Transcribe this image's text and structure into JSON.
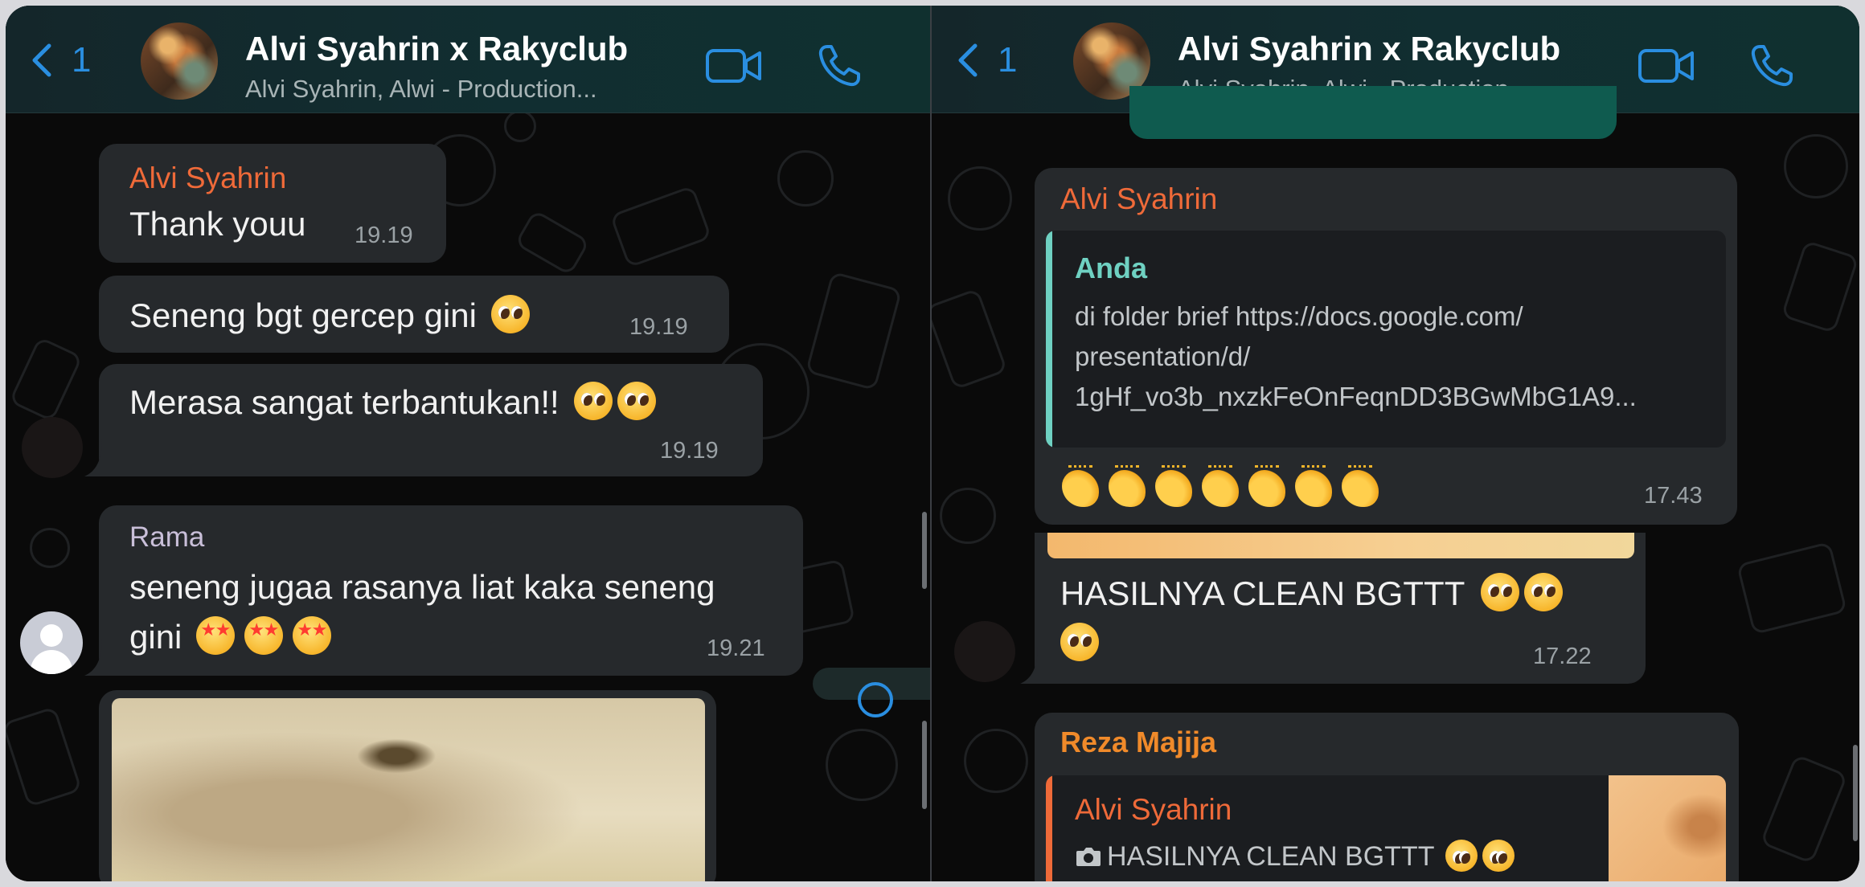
{
  "header": {
    "back_count": "1",
    "title": "Alvi Syahrin x Rakyclub",
    "subtitle": "Alvi Syahrin, Alwi - Production...",
    "accent_color": "#2a8ee0",
    "icons": [
      "chevron-left-icon",
      "video-call-icon",
      "phone-icon"
    ]
  },
  "left_chat": {
    "messages": [
      {
        "sender": "Alvi Syahrin",
        "text": "Thank youu",
        "time": "19.19"
      },
      {
        "text": "Seneng bgt gercep gini",
        "time": "19.19"
      },
      {
        "text": "Merasa sangat terbantukan!!",
        "time": "19.19"
      },
      {
        "sender": "Rama",
        "text_line1": "seneng jugaa rasanya liat kaka seneng",
        "text_line2": "gini",
        "time": "19.21"
      }
    ]
  },
  "right_chat": {
    "quoted_message": {
      "sender": "Alvi Syahrin",
      "quote_author": "Anda",
      "quote_line1": "di folder brief https://docs.google.com/",
      "quote_line2": "presentation/d/",
      "quote_line3": "1gHf_vo3b_nxzkFeOnFeqnDD3BGwMbG1A9...",
      "time": "17.43"
    },
    "caption_message": {
      "text_line1": "HASILNYA CLEAN BGTTT",
      "time": "17.22"
    },
    "reply_message": {
      "sender": "Reza Majija",
      "quote_author": "Alvi Syahrin",
      "quote_text": "HASILNYA CLEAN BGTTT"
    }
  },
  "colors": {
    "sender_alvi": "#ef6a39",
    "sender_rama": "#c9bfd9",
    "sender_reza": "#f08a2a",
    "quote_anda": "#6fd1c2",
    "time": "#9aa1a5"
  }
}
